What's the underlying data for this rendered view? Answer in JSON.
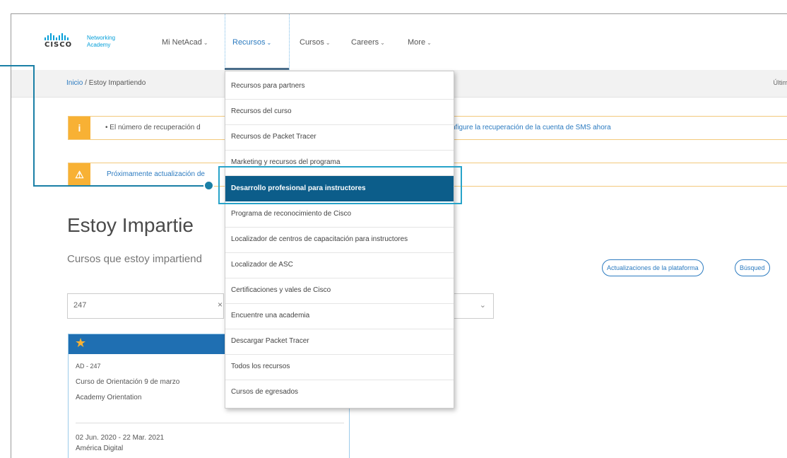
{
  "logo": {
    "brand": "CISCO",
    "product_line1": "Networking",
    "product_line2": "Academy"
  },
  "nav": {
    "items": [
      {
        "label": "Mi NetAcad",
        "caret": "⌄"
      },
      {
        "label": "Recursos",
        "caret": "⌄"
      },
      {
        "label": "Cursos",
        "caret": "⌄"
      },
      {
        "label": "Careers",
        "caret": "⌄"
      },
      {
        "label": "More",
        "caret": "⌄"
      }
    ]
  },
  "breadcrumb": {
    "home": "Inicio",
    "separator": " / ",
    "current": "Estoy Impartiendo",
    "right_text": "Últim"
  },
  "alerts": [
    {
      "icon": "info-icon",
      "text": "• El número de recuperación d",
      "link": "nfigure la recuperación de la cuenta de SMS ahora"
    },
    {
      "icon": "warning-icon",
      "text": "Próximamente actualización de"
    }
  ],
  "page": {
    "title": "Estoy Impartie",
    "subtitle": "Cursos que estoy impartiend",
    "search_value": "247",
    "search_clear": "×",
    "select_chevron": "⌄",
    "buttons": {
      "updates": "Actualizaciones de la plataforma",
      "search": "Búsqued"
    }
  },
  "card": {
    "star": "★",
    "code": "AD - 247",
    "course": "Curso de Orientación 9 de marzo",
    "type": "Academy Orientation",
    "dates": "02 Jun. 2020 - 22 Mar. 2021",
    "org": "América Digital"
  },
  "dropdown": {
    "items": [
      {
        "label": "Recursos para partners"
      },
      {
        "label": "Recursos del curso"
      },
      {
        "label": "Recursos de Packet Tracer"
      },
      {
        "label": "Marketing y recursos del programa"
      },
      {
        "label": "Desarrollo profesional para instructores",
        "active": true
      },
      {
        "label": "Programa de reconocimiento de Cisco"
      },
      {
        "label": "Localizador de centros de capacitación para instructores"
      },
      {
        "label": "Localizador de ASC"
      },
      {
        "label": "Certificaciones y vales de Cisco"
      },
      {
        "label": "Encuentre una academia"
      },
      {
        "label": "Descargar Packet Tracer"
      },
      {
        "label": "Todos los recursos"
      },
      {
        "label": "Cursos de egresados"
      }
    ]
  },
  "colors": {
    "accent": "#049fd9",
    "active_item": "#0c5d8a",
    "alert": "#f8b134",
    "callout": "#27a3c9",
    "card_header": "#1f6fb2"
  }
}
